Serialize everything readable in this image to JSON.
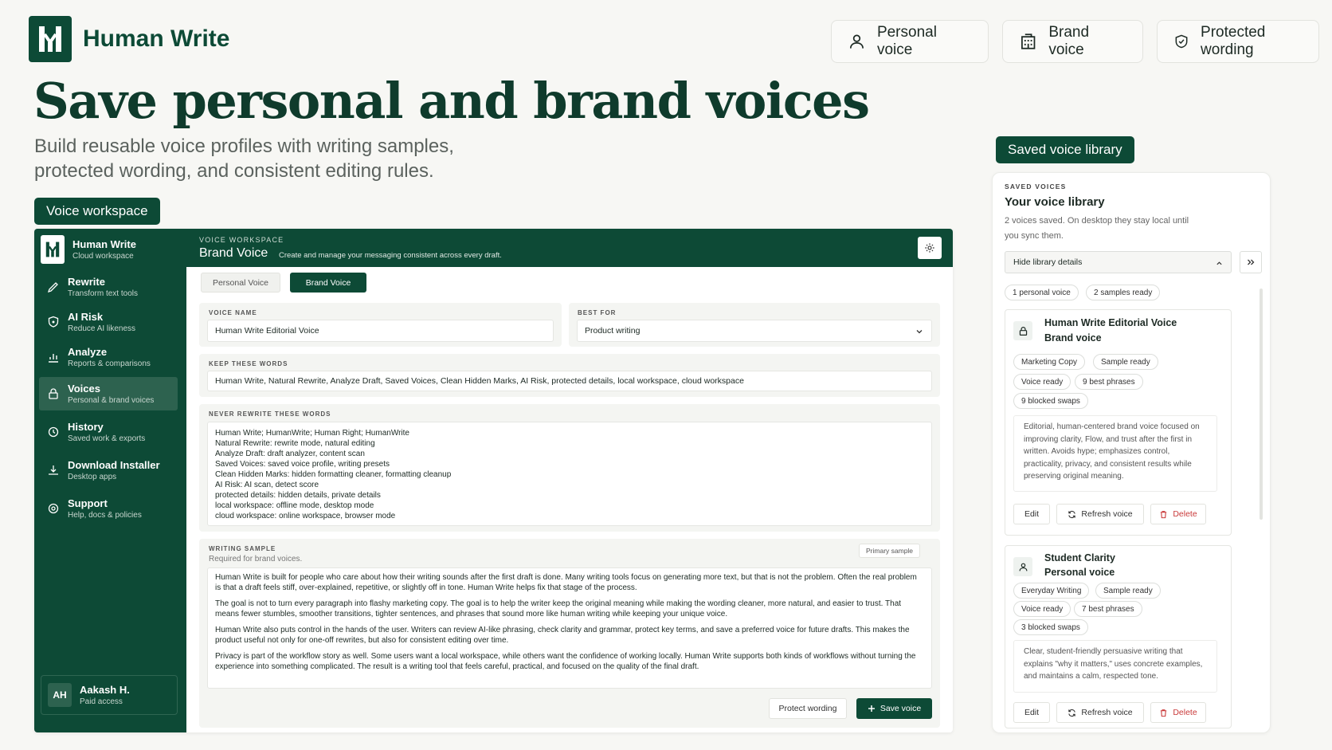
{
  "brand": {
    "name": "Human Write"
  },
  "header_chips": [
    {
      "label": "Personal voice",
      "icon": "person-icon"
    },
    {
      "label": "Brand voice",
      "icon": "building-icon"
    },
    {
      "label": "Protected wording",
      "icon": "shield-icon"
    }
  ],
  "hero": {
    "title": "Save personal and brand voices",
    "subtitle": "Build reusable voice profiles with writing samples, protected wording, and consistent editing rules."
  },
  "labels": {
    "workspace": "Voice workspace",
    "library": "Saved voice library"
  },
  "sidebar": {
    "workspace_name": "Human Write",
    "workspace_type": "Cloud workspace",
    "items": [
      {
        "title": "Rewrite",
        "sub": "Transform text tools"
      },
      {
        "title": "AI Risk",
        "sub": "Reduce AI likeness"
      },
      {
        "title": "Analyze",
        "sub": "Reports & comparisons"
      },
      {
        "title": "Voices",
        "sub": "Personal & brand voices"
      },
      {
        "title": "History",
        "sub": "Saved work & exports"
      },
      {
        "title": "Download Installer",
        "sub": "Desktop apps"
      },
      {
        "title": "Support",
        "sub": "Help, docs & policies"
      }
    ],
    "user": {
      "initials": "AH",
      "name": "Aakash H.",
      "plan": "Paid access"
    }
  },
  "topbar": {
    "kicker": "VOICE WORKSPACE",
    "title": "Brand Voice",
    "desc": "Create and manage your messaging consistent across every draft."
  },
  "tabs": [
    "Personal Voice",
    "Brand Voice"
  ],
  "form": {
    "voice_name_label": "VOICE NAME",
    "voice_name": "Human Write Editorial Voice",
    "best_for_label": "BEST FOR",
    "best_for": "Product writing",
    "keep_label": "KEEP THESE WORDS",
    "keep_words": "Human Write, Natural Rewrite, Analyze Draft, Saved Voices, Clean Hidden Marks, AI Risk, protected details, local workspace, cloud workspace",
    "never_label": "NEVER REWRITE THESE WORDS",
    "never_words": "Human Write; HumanWrite; Human Right; HumanWrite\nNatural Rewrite: rewrite mode, natural editing\nAnalyze Draft: draft analyzer, content scan\nSaved Voices: saved voice profile, writing presets\nClean Hidden Marks: hidden formatting cleaner, formatting cleanup\nAI Risk: AI scan, detect score\nprotected details: hidden details, private details\nlocal workspace: offline mode, desktop mode\ncloud workspace: online workspace, browser mode",
    "sample_label": "WRITING SAMPLE",
    "sample_sub": "Required for brand voices.",
    "sample_badge": "Primary sample",
    "sample_paragraphs": [
      "Human Write is built for people who care about how their writing sounds after the first draft is done. Many writing tools focus on generating more text, but that is not the problem. Often the real problem is that a draft feels stiff, over-explained, repetitive, or slightly off in tone. Human Write helps fix that stage of the process.",
      "The goal is not to turn every paragraph into flashy marketing copy. The goal is to help the writer keep the original meaning while making the wording cleaner, more natural, and easier to trust. That means fewer stumbles, smoother transitions, tighter sentences, and phrases that sound more like human writing while keeping your unique voice.",
      "Human Write also puts control in the hands of the user. Writers can review AI-like phrasing, check clarity and grammar, protect key terms, and save a preferred voice for future drafts. This makes the product useful not only for one-off rewrites, but also for consistent editing over time.",
      "Privacy is part of the workflow story as well. Some users want a local workspace, while others want the confidence of working locally. Human Write supports both kinds of workflows without turning the experience into something complicated. The result is a writing tool that feels careful, practical, and focused on the quality of the final draft."
    ],
    "protect_btn": "Protect wording",
    "save_btn": "Save voice"
  },
  "library": {
    "kicker": "SAVED VOICES",
    "title": "Your voice library",
    "desc": "2 voices saved. On desktop they stay local until you sync them.",
    "toggle": "Hide library details",
    "summary_tags": [
      "1 personal voice",
      "2 samples ready"
    ],
    "cards": [
      {
        "title": "Human Write Editorial Voice",
        "type": "Brand voice",
        "tags": [
          "Marketing Copy",
          "Sample ready",
          "Voice ready",
          "9 best phrases",
          "9 blocked swaps"
        ],
        "desc": "Editorial, human-centered brand voice focused on improving clarity, Flow, and trust after the first in written. Avoids hype; emphasizes control, practicality, privacy, and consistent results while preserving original meaning."
      },
      {
        "title": "Student Clarity",
        "type": "Personal voice",
        "tags": [
          "Everyday Writing",
          "Sample ready",
          "Voice ready",
          "7 best phrases",
          "3 blocked swaps"
        ],
        "desc": "Clear, student-friendly persuasive writing that explains \"why it matters,\" uses concrete examples, and maintains a calm, respected tone."
      }
    ],
    "edit": "Edit",
    "refresh": "Refresh voice",
    "delete": "Delete"
  }
}
